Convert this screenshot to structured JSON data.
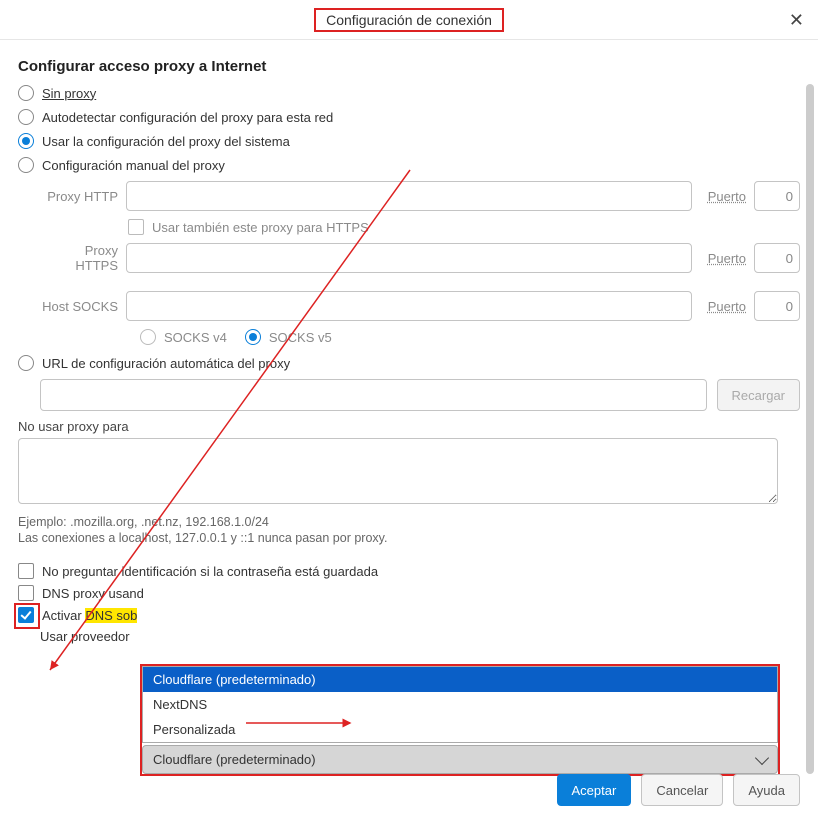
{
  "dialog": {
    "title": "Configuración de conexión",
    "heading": "Configurar acceso proxy a Internet"
  },
  "radios": {
    "none": "Sin proxy",
    "auto": "Autodetectar configuración del proxy para esta red",
    "system": "Usar la configuración del proxy del sistema",
    "manual": "Configuración manual del proxy",
    "url": "URL de configuración automática del proxy"
  },
  "fields": {
    "http_label": "Proxy HTTP",
    "https_label": "Proxy HTTPS",
    "socks_label": "Host SOCKS",
    "port_label": "Puerto",
    "port_value": "0",
    "also_https": "Usar también este proxy para HTTPS",
    "socks4": "SOCKS v4",
    "socks5": "SOCKS v5",
    "reload": "Recargar"
  },
  "noproxy": {
    "label": "No usar proxy para",
    "example": "Ejemplo: .mozilla.org, .net.nz, 192.168.1.0/24",
    "note": "Las conexiones a localhost, 127.0.0.1 y ::1 nunca pasan por proxy."
  },
  "checks": {
    "no_prompt": "No preguntar identificación si la contraseña está guardada",
    "dns_proxy": "DNS proxy usand",
    "doh_prefix": "Activar ",
    "doh_highlight": "DNS sob",
    "provider_label": "Usar proveedor"
  },
  "dropdown": {
    "opt1": "Cloudflare (predeterminado)",
    "opt2": "NextDNS",
    "opt3": "Personalizada",
    "selected": "Cloudflare (predeterminado)"
  },
  "buttons": {
    "ok": "Aceptar",
    "cancel": "Cancelar",
    "help": "Ayuda"
  }
}
